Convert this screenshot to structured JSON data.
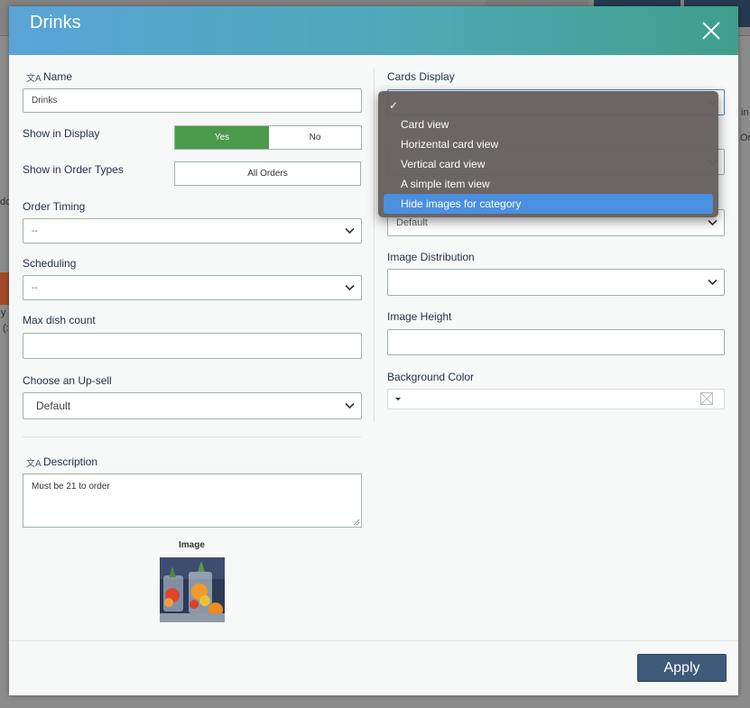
{
  "modal": {
    "title": "Drinks",
    "apply_label": "Apply"
  },
  "left": {
    "name": {
      "label": "Name",
      "value": "Drinks"
    },
    "show_in_display": {
      "label": "Show in Display",
      "yes": "Yes",
      "no": "No",
      "selected": "Yes"
    },
    "show_in_order_types": {
      "label": "Show in Order Types",
      "value": "All Orders"
    },
    "order_timing": {
      "label": "Order Timing",
      "value": "--"
    },
    "scheduling": {
      "label": "Scheduling",
      "value": "--"
    },
    "max_dish_count": {
      "label": "Max dish count",
      "value": ""
    },
    "upsell": {
      "label": "Choose an Up-sell",
      "value": "Default"
    },
    "description": {
      "label": "Description",
      "value": "Must be 21 to order"
    },
    "image": {
      "label": "Image"
    }
  },
  "right": {
    "cards_display": {
      "label": "Cards Display"
    },
    "hidden_select": {
      "value": "Default"
    },
    "image_distribution": {
      "label": "Image Distribution",
      "value": ""
    },
    "image_height": {
      "label": "Image Height",
      "value": ""
    },
    "background_color": {
      "label": "Background Color"
    }
  },
  "dropdown": {
    "check": "✓",
    "items": [
      "Card view",
      "Horizental card view",
      "Vertical card view",
      "A simple item view",
      "Hide images for category"
    ],
    "selected_index": 4
  },
  "background_fragments": {
    "a": "in",
    "b": "Or",
    "c": "dd",
    "d": "y",
    "e": "(:"
  },
  "colors": {
    "header_start": "#5aa4d8",
    "header_end": "#3f9f8c",
    "toggle_yes": "#4b9a49",
    "apply": "#3f5a79",
    "dropdown_highlight": "#4a8fe0"
  }
}
